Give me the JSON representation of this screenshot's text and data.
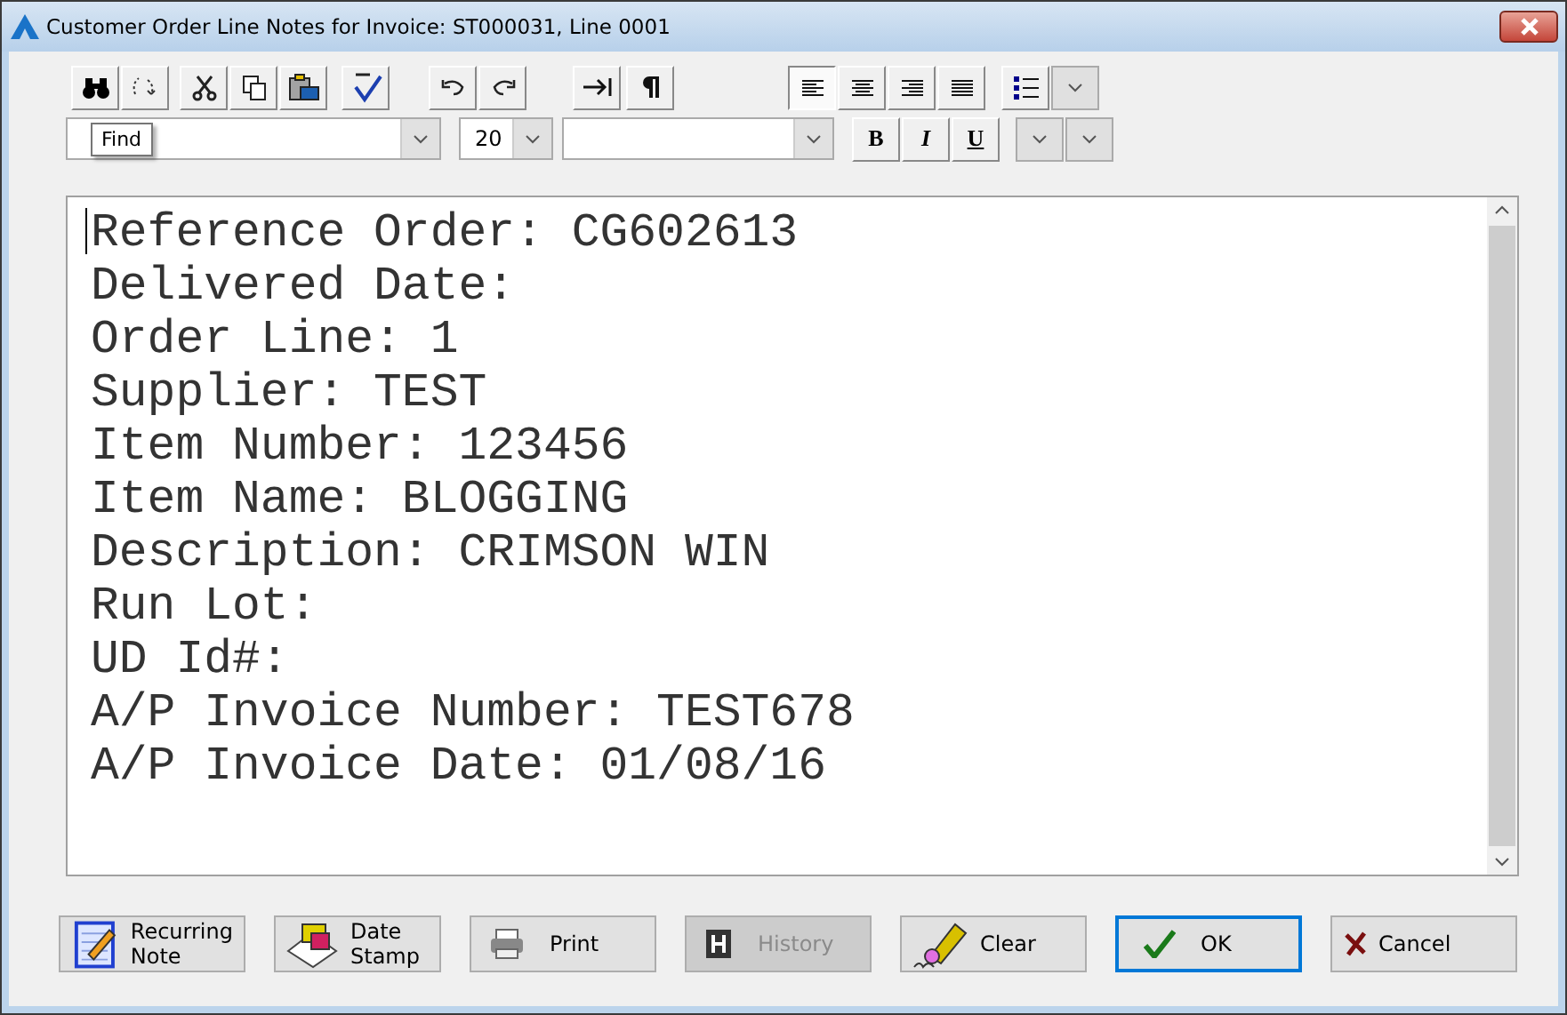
{
  "window": {
    "title": "Customer Order Line Notes for Invoice: ST000031, Line 0001"
  },
  "alignment_buttons": [
    {
      "kind": "left",
      "selected": true
    },
    {
      "kind": "center",
      "selected": false
    },
    {
      "kind": "right",
      "selected": false
    },
    {
      "kind": "justify",
      "selected": false
    }
  ],
  "font_size": {
    "value": "20"
  },
  "format_buttons": [
    {
      "kind": "bold",
      "label": "B"
    },
    {
      "kind": "italic",
      "label": "I"
    },
    {
      "kind": "underline",
      "label": "U"
    }
  ],
  "tooltip": {
    "text": "Find"
  },
  "editor": {
    "lines": [
      "Reference Order: CG602613",
      "Delivered Date:",
      "Order Line: 1",
      "Supplier: TEST",
      "Item Number: 123456",
      "Item Name: BLOGGING",
      "Description: CRIMSON WIN",
      "Run Lot:",
      "UD Id#:",
      "A/P Invoice Number: TEST678",
      "A/P Invoice Date: 01/08/16"
    ]
  },
  "buttons": [
    {
      "kind": "recurring",
      "lines": [
        "Recurring",
        "Note"
      ],
      "disabled": false,
      "default": false
    },
    {
      "kind": "date",
      "lines": [
        "Date",
        "Stamp"
      ],
      "disabled": false,
      "default": false
    },
    {
      "kind": "print",
      "lines": [
        "Print"
      ],
      "disabled": false,
      "default": false
    },
    {
      "kind": "history",
      "lines": [
        "History"
      ],
      "disabled": true,
      "default": false
    },
    {
      "kind": "clear",
      "lines": [
        "Clear"
      ],
      "disabled": false,
      "default": false
    },
    {
      "kind": "ok",
      "lines": [
        "OK"
      ],
      "disabled": false,
      "default": true
    },
    {
      "kind": "cancel",
      "lines": [
        "Cancel"
      ],
      "disabled": false,
      "default": false
    }
  ]
}
